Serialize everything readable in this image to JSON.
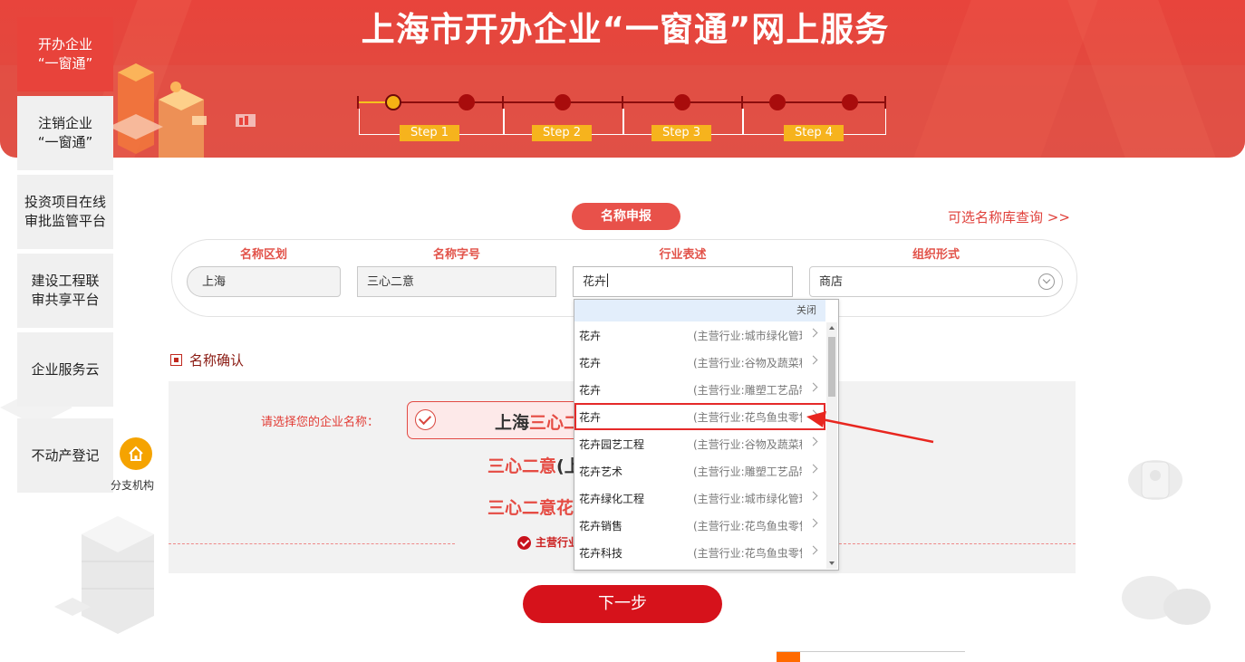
{
  "banner": {
    "title": "上海市开办企业“一窗通”网上服务",
    "steps": [
      "Step 1",
      "Step 2",
      "Step 3",
      "Step 4"
    ]
  },
  "nav": {
    "items": [
      {
        "label": "开办企业\n“一窗通”",
        "active": true
      },
      {
        "label": "注销企业\n“一窗通”",
        "active": false
      },
      {
        "label": "投资项目在线\n审批监管平台",
        "active": false
      },
      {
        "label": "建设工程联\n审共享平台",
        "active": false
      },
      {
        "label": "企业服务云",
        "active": false
      },
      {
        "label": "不动产登记",
        "active": false
      }
    ],
    "branch_label": "分支机构"
  },
  "form": {
    "section_title": "名称申报",
    "library_link": "可选名称库查询 >>",
    "labels": [
      "名称区划",
      "名称字号",
      "行业表述",
      "组织形式"
    ],
    "region_value": "上海",
    "trade_name_value": "三心二意",
    "industry_value": "花卉",
    "org_form_value": "商店"
  },
  "dropdown": {
    "close_label": "关闭",
    "items": [
      {
        "name": "花卉",
        "desc": "(主营行业:城市绿化管理)"
      },
      {
        "name": "花卉",
        "desc": "(主营行业:谷物及蔬菜种植)"
      },
      {
        "name": "花卉",
        "desc": "(主营行业:雕塑工艺品制造)"
      },
      {
        "name": "花卉",
        "desc": "(主营行业:花鸟鱼虫零售)",
        "highlighted": true
      },
      {
        "name": "花卉园艺工程",
        "desc": "(主营行业:谷物及蔬菜种植)"
      },
      {
        "name": "花卉艺术",
        "desc": "(主营行业:雕塑工艺品制造)"
      },
      {
        "name": "花卉绿化工程",
        "desc": "(主营行业:城市绿化管理)"
      },
      {
        "name": "花卉销售",
        "desc": "(主营行业:花鸟鱼虫零售)"
      },
      {
        "name": "花卉科技",
        "desc": "(主营行业:花鸟鱼虫零售)"
      }
    ]
  },
  "confirm": {
    "section_title": "名称确认",
    "choose_label": "请选择您的企业名称：",
    "selected_name_prefix": "上海",
    "selected_name_rest": "三心二",
    "option1_red": "三心二意",
    "option1_black": "(上",
    "option2": "三心二意花",
    "main_industry": "主营行业"
  },
  "next_button": "下一步",
  "colors": {
    "brand_red": "#e8433b",
    "step_yellow": "#f6b31d",
    "button_red": "#d6121b"
  }
}
